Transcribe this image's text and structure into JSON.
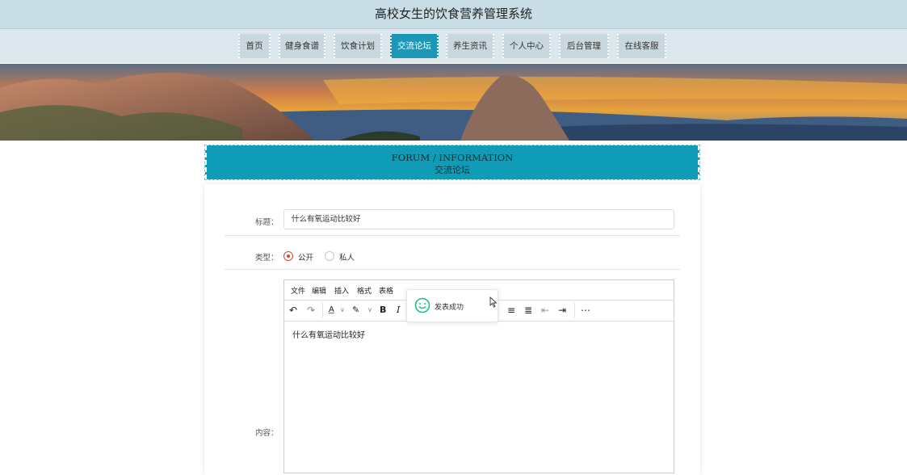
{
  "site": {
    "title": "高校女生的饮食营养管理系统"
  },
  "nav": {
    "items": [
      {
        "label": "首页"
      },
      {
        "label": "健身食谱"
      },
      {
        "label": "饮食计划"
      },
      {
        "label": "交流论坛"
      },
      {
        "label": "养生资讯"
      },
      {
        "label": "个人中心"
      },
      {
        "label": "后台管理"
      },
      {
        "label": "在线客服"
      }
    ],
    "active": "交流论坛"
  },
  "section": {
    "title_en": "FORUM / INFORMATION",
    "title_cn": "交流论坛"
  },
  "form": {
    "title_label": "标题：",
    "title_value": "什么有氧运动比较好",
    "type_label": "类型：",
    "type_options": [
      {
        "label": "公开",
        "checked": true
      },
      {
        "label": "私人",
        "checked": false
      }
    ],
    "content_label": "内容："
  },
  "editor": {
    "menu": [
      "文件",
      "编辑",
      "插入",
      "格式",
      "表格"
    ],
    "toolbar_icons": [
      "undo-icon",
      "redo-icon",
      "font-color-icon",
      "highlight-color-icon",
      "bold-icon",
      "italic-icon",
      "align-right-icon",
      "justify-icon",
      "outdent-icon",
      "indent-icon",
      "more-icon"
    ],
    "content": "什么有氧运动比较好"
  },
  "toast": {
    "message": "发表成功",
    "icon": "smile-icon"
  },
  "colors": {
    "accent": "#1a98b5",
    "header_bg": "#c8dde6",
    "radio_checked": "#d9463a"
  }
}
